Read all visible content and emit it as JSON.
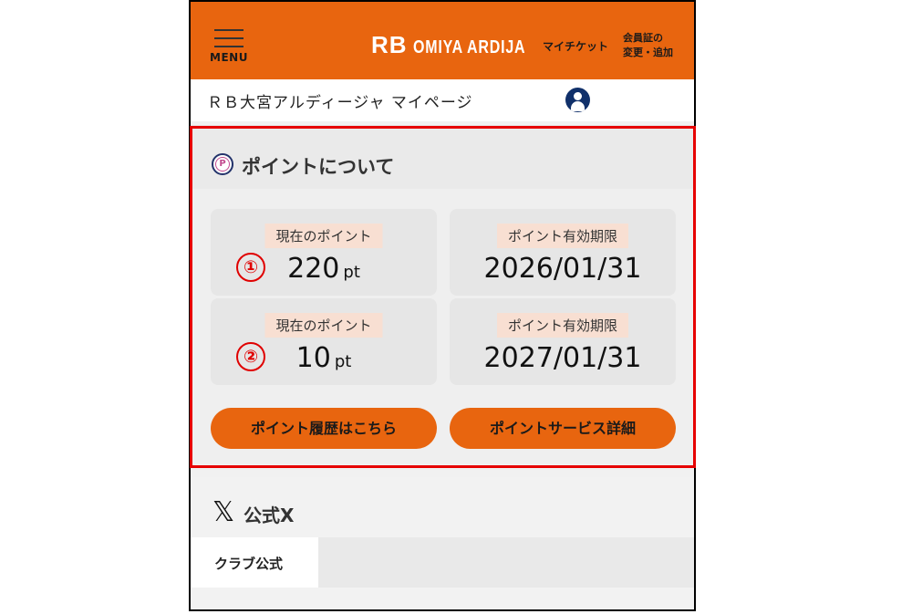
{
  "header": {
    "menu_label": "MENU",
    "logo_rb": "RB",
    "logo_name": "OMIYA ARDIJA",
    "my_ticket": "マイチケット",
    "member_card_line1": "会員証の",
    "member_card_line2": "変更・追加",
    "accent_color": "#e8650f"
  },
  "subbar": {
    "title": "ＲＢ大宮アルディージャ マイページ",
    "user_icon": "user-icon"
  },
  "points": {
    "section_title": "ポイントについて",
    "icon": "point-p-icon",
    "icon_letter": "P",
    "rows": [
      {
        "marker": "①",
        "current_label": "現在のポイント",
        "current_value": "220",
        "unit": "pt",
        "expiry_label": "ポイント有効期限",
        "expiry_value": "2026/01/31"
      },
      {
        "marker": "②",
        "current_label": "現在のポイント",
        "current_value": "10",
        "unit": "pt",
        "expiry_label": "ポイント有効期限",
        "expiry_value": "2027/01/31"
      }
    ],
    "history_button": "ポイント履歴はこちら",
    "service_button": "ポイントサービス詳細",
    "highlight_color": "#e60000"
  },
  "x_section": {
    "icon": "x-logo-icon",
    "icon_glyph": "𝕏",
    "title": "公式X",
    "tabs": [
      {
        "label": "クラブ公式",
        "active": true
      }
    ]
  }
}
